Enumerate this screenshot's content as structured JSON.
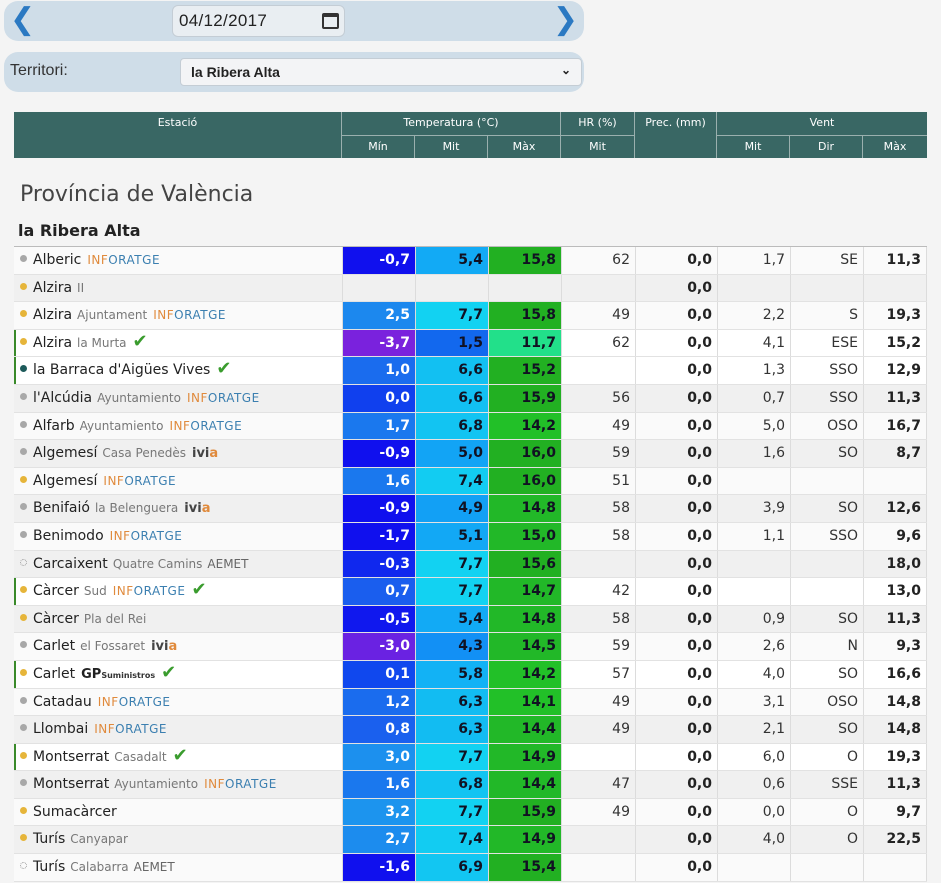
{
  "date_nav": {
    "prev_icon": "chevron-left-icon",
    "next_icon": "chevron-right-icon",
    "date_value": "04/12/2017",
    "calendar_icon": "calendar-icon"
  },
  "territory": {
    "label": "Territori:",
    "selected": "la Ribera Alta"
  },
  "table_header": {
    "estacio": "Estació",
    "temperatura": "Temperatura (°C)",
    "hr": "HR (%)",
    "prec": "Prec. (mm)",
    "vent": "Vent",
    "min": "Mín",
    "mit": "Mit",
    "max": "Màx",
    "hr_mit": "Mit",
    "vent_mit": "Mit",
    "vent_dir": "Dir",
    "vent_max": "Màx"
  },
  "province_title": "Província de València",
  "region_title": "la Ribera Alta",
  "colors": {
    "header_bg": "#396764",
    "nav_blue": "#2b79c2",
    "check_green": "#3a9c2e"
  },
  "stations": [
    {
      "name": "Alberic",
      "sub": "",
      "logo": "INFORATGE",
      "dot": "gray",
      "check": false,
      "hl": false,
      "min": "-0,7",
      "mit": "5,4",
      "max": "15,8",
      "hr": "62",
      "prec": "0,0",
      "vm": "1,7",
      "dir": "SE",
      "vx": "11,3",
      "cmin": "#1010ee",
      "cmit": "#12aaf5",
      "cmax": "#22b022"
    },
    {
      "name": "Alzira",
      "sub": "II",
      "logo": "",
      "dot": "yellow",
      "check": false,
      "hl": false,
      "min": "",
      "mit": "",
      "max": "",
      "hr": "",
      "prec": "0,0",
      "vm": "",
      "dir": "",
      "vx": "",
      "cmin": "",
      "cmit": "",
      "cmax": ""
    },
    {
      "name": "Alzira",
      "sub": "Ajuntament",
      "logo": "INFORATGE",
      "dot": "yellow",
      "check": false,
      "hl": false,
      "min": "2,5",
      "mit": "7,7",
      "max": "15,8",
      "hr": "49",
      "prec": "0,0",
      "vm": "2,2",
      "dir": "S",
      "vx": "19,3",
      "cmin": "#1c88ee",
      "cmit": "#12d2f2",
      "cmax": "#22b022"
    },
    {
      "name": "Alzira",
      "sub": "la Murta",
      "logo": "",
      "dot": "yellow",
      "check": true,
      "hl": true,
      "min": "-3,7",
      "mit": "1,5",
      "max": "11,7",
      "hr": "62",
      "prec": "0,0",
      "vm": "4,1",
      "dir": "ESE",
      "vx": "15,2",
      "cmin": "#7a22dd",
      "cmit": "#1268ee",
      "cmax": "#22e08a"
    },
    {
      "name": "la Barraca d'Aigües Vives",
      "sub": "",
      "logo": "",
      "dot": "dark",
      "check": true,
      "hl": true,
      "min": "1,0",
      "mit": "6,6",
      "max": "15,2",
      "hr": "",
      "prec": "0,0",
      "vm": "1,3",
      "dir": "SSO",
      "vx": "12,9",
      "cmin": "#1a6cee",
      "cmit": "#12c0f2",
      "cmax": "#22b022"
    },
    {
      "name": "l'Alcúdia",
      "sub": "Ayuntamiento",
      "logo": "INFORATGE",
      "dot": "gray",
      "check": false,
      "hl": false,
      "min": "0,0",
      "mit": "6,6",
      "max": "15,9",
      "hr": "56",
      "prec": "0,0",
      "vm": "0,7",
      "dir": "SSO",
      "vx": "11,3",
      "cmin": "#1040ee",
      "cmit": "#12c0f2",
      "cmax": "#22b022"
    },
    {
      "name": "Alfarb",
      "sub": "Ayuntamiento",
      "logo": "INFORATGE",
      "dot": "gray",
      "check": false,
      "hl": false,
      "min": "1,7",
      "mit": "6,8",
      "max": "14,2",
      "hr": "49",
      "prec": "0,0",
      "vm": "5,0",
      "dir": "OSO",
      "vx": "16,7",
      "cmin": "#1a78ee",
      "cmit": "#12c4f2",
      "cmax": "#22c028"
    },
    {
      "name": "Algemesí",
      "sub": "Casa Penedès",
      "logo": "ivia",
      "dot": "gray",
      "check": false,
      "hl": false,
      "min": "-0,9",
      "mit": "5,0",
      "max": "16,0",
      "hr": "59",
      "prec": "0,0",
      "vm": "1,6",
      "dir": "SO",
      "vx": "8,7",
      "cmin": "#1010ee",
      "cmit": "#12a4f5",
      "cmax": "#22b022"
    },
    {
      "name": "Algemesí",
      "sub": "",
      "logo": "INFORATGE",
      "dot": "yellow",
      "check": false,
      "hl": false,
      "min": "1,6",
      "mit": "7,4",
      "max": "16,0",
      "hr": "51",
      "prec": "0,0",
      "vm": "",
      "dir": "",
      "vx": "",
      "cmin": "#1a78ee",
      "cmit": "#12ccf2",
      "cmax": "#22b022"
    },
    {
      "name": "Benifaió",
      "sub": "la Belenguera",
      "logo": "ivia",
      "dot": "gray",
      "check": false,
      "hl": false,
      "min": "-0,9",
      "mit": "4,9",
      "max": "14,8",
      "hr": "58",
      "prec": "0,0",
      "vm": "3,9",
      "dir": "SO",
      "vx": "12,6",
      "cmin": "#1010ee",
      "cmit": "#12a0f5",
      "cmax": "#22b828"
    },
    {
      "name": "Benimodo",
      "sub": "",
      "logo": "INFORATGE",
      "dot": "gray",
      "check": false,
      "hl": false,
      "min": "-1,7",
      "mit": "5,1",
      "max": "15,0",
      "hr": "58",
      "prec": "0,0",
      "vm": "1,1",
      "dir": "SSO",
      "vx": "9,6",
      "cmin": "#1010ee",
      "cmit": "#12a8f5",
      "cmax": "#22b828"
    },
    {
      "name": "Carcaixent",
      "sub": "Quatre Camins",
      "logo": "AEMET",
      "dot": "hollow",
      "check": false,
      "hl": false,
      "min": "-0,3",
      "mit": "7,7",
      "max": "15,6",
      "hr": "",
      "prec": "0,0",
      "vm": "",
      "dir": "",
      "vx": "18,0",
      "cmin": "#1028ee",
      "cmit": "#12d2f2",
      "cmax": "#22b022"
    },
    {
      "name": "Càrcer",
      "sub": "Sud",
      "logo": "INFORATGE",
      "dot": "yellow",
      "check": true,
      "hl": true,
      "min": "0,7",
      "mit": "7,7",
      "max": "14,7",
      "hr": "42",
      "prec": "0,0",
      "vm": "",
      "dir": "",
      "vx": "13,0",
      "cmin": "#1a5eee",
      "cmit": "#12d2f2",
      "cmax": "#22b828"
    },
    {
      "name": "Càrcer",
      "sub": "Pla del Rei",
      "logo": "",
      "dot": "yellow",
      "check": false,
      "hl": false,
      "min": "-0,5",
      "mit": "5,4",
      "max": "14,8",
      "hr": "58",
      "prec": "0,0",
      "vm": "0,9",
      "dir": "SO",
      "vx": "11,3",
      "cmin": "#1018ee",
      "cmit": "#12aaf5",
      "cmax": "#22b828"
    },
    {
      "name": "Carlet",
      "sub": "el Fossaret",
      "logo": "ivia",
      "dot": "gray",
      "check": false,
      "hl": false,
      "min": "-3,0",
      "mit": "4,3",
      "max": "14,5",
      "hr": "59",
      "prec": "0,0",
      "vm": "2,6",
      "dir": "N",
      "vx": "9,3",
      "cmin": "#6a22e2",
      "cmit": "#1290f5",
      "cmax": "#22b828"
    },
    {
      "name": "Carlet",
      "sub": "",
      "logo": "GP",
      "dot": "yellow",
      "check": true,
      "hl": true,
      "min": "0,1",
      "mit": "5,8",
      "max": "14,2",
      "hr": "57",
      "prec": "0,0",
      "vm": "4,0",
      "dir": "SO",
      "vx": "16,6",
      "cmin": "#1048ee",
      "cmit": "#12b2f5",
      "cmax": "#22c028"
    },
    {
      "name": "Catadau",
      "sub": "",
      "logo": "INFORATGE",
      "dot": "gray",
      "check": false,
      "hl": false,
      "min": "1,2",
      "mit": "6,3",
      "max": "14,1",
      "hr": "49",
      "prec": "0,0",
      "vm": "3,1",
      "dir": "OSO",
      "vx": "14,8",
      "cmin": "#1a6cee",
      "cmit": "#12bcf2",
      "cmax": "#22c028"
    },
    {
      "name": "Llombai",
      "sub": "",
      "logo": "INFORATGE",
      "dot": "gray",
      "check": false,
      "hl": false,
      "min": "0,8",
      "mit": "6,3",
      "max": "14,4",
      "hr": "49",
      "prec": "0,0",
      "vm": "2,1",
      "dir": "SO",
      "vx": "14,8",
      "cmin": "#1a60ee",
      "cmit": "#12bcf2",
      "cmax": "#22b828"
    },
    {
      "name": "Montserrat",
      "sub": "Casadalt",
      "logo": "",
      "dot": "yellow",
      "check": true,
      "hl": true,
      "min": "3,0",
      "mit": "7,7",
      "max": "14,9",
      "hr": "",
      "prec": "0,0",
      "vm": "6,0",
      "dir": "O",
      "vx": "19,3",
      "cmin": "#1c90ee",
      "cmit": "#12d2f2",
      "cmax": "#22b828"
    },
    {
      "name": "Montserrat",
      "sub": "Ayuntamiento",
      "logo": "INFORATGE",
      "dot": "gray",
      "check": false,
      "hl": false,
      "min": "1,6",
      "mit": "6,8",
      "max": "14,4",
      "hr": "47",
      "prec": "0,0",
      "vm": "0,6",
      "dir": "SSE",
      "vx": "11,3",
      "cmin": "#1a78ee",
      "cmit": "#12c4f2",
      "cmax": "#22b828"
    },
    {
      "name": "Sumacàrcer",
      "sub": "",
      "logo": "",
      "dot": "yellow",
      "check": false,
      "hl": false,
      "min": "3,2",
      "mit": "7,7",
      "max": "15,9",
      "hr": "49",
      "prec": "0,0",
      "vm": "0,0",
      "dir": "O",
      "vx": "9,7",
      "cmin": "#1c94ee",
      "cmit": "#12d2f2",
      "cmax": "#22b022"
    },
    {
      "name": "Turís",
      "sub": "Canyapar",
      "logo": "",
      "dot": "yellow",
      "check": false,
      "hl": false,
      "min": "2,7",
      "mit": "7,4",
      "max": "14,9",
      "hr": "",
      "prec": "0,0",
      "vm": "4,0",
      "dir": "O",
      "vx": "22,5",
      "cmin": "#1c8cee",
      "cmit": "#12ccf2",
      "cmax": "#22b828"
    },
    {
      "name": "Turís",
      "sub": "Calabarra",
      "logo": "AEMET",
      "dot": "hollow",
      "check": false,
      "hl": false,
      "min": "-1,6",
      "mit": "6,9",
      "max": "15,4",
      "hr": "",
      "prec": "0,0",
      "vm": "",
      "dir": "",
      "vx": "",
      "cmin": "#1010ee",
      "cmit": "#12c6f2",
      "cmax": "#22b022"
    }
  ]
}
